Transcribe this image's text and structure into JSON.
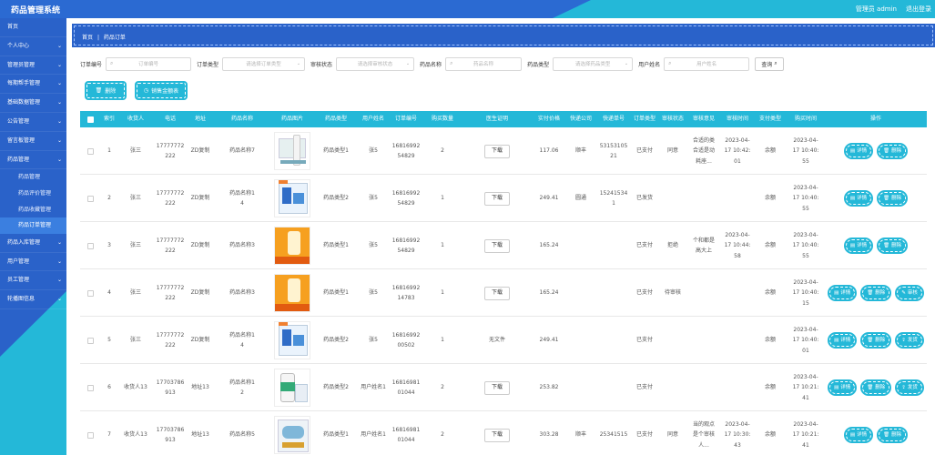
{
  "app": {
    "title": "药品管理系统",
    "user_label": "管理员 admin",
    "logout_label": "退出登录"
  },
  "sidebar": {
    "items": [
      {
        "label": "首页",
        "chevron": false
      },
      {
        "label": "个人中心",
        "chevron": true
      },
      {
        "label": "管理员管理",
        "chevron": true
      },
      {
        "label": "每期帮手管理",
        "chevron": true
      },
      {
        "label": "基础数据管理",
        "chevron": true
      },
      {
        "label": "公告管理",
        "chevron": true
      },
      {
        "label": "留言板管理",
        "chevron": true
      },
      {
        "label": "药品管理",
        "chevron": true
      }
    ],
    "subitems": [
      "药品管理",
      "药品评价管理",
      "药品收藏管理",
      "药品订单管理"
    ],
    "items_after": [
      {
        "label": "药品入库管理",
        "chevron": true
      },
      {
        "label": "用户管理",
        "chevron": true
      },
      {
        "label": "员工管理",
        "chevron": true
      },
      {
        "label": "轮播图信息",
        "chevron": true
      }
    ]
  },
  "breadcrumb": {
    "home": "首页",
    "sep": "|",
    "current": "药品订单"
  },
  "filters": {
    "order_no_label": "订单编号",
    "order_no_placeholder": "订单编号",
    "order_type_label": "订单类型",
    "order_type_placeholder": "请选择订单类型",
    "audit_label": "审核状态",
    "audit_placeholder": "请选择审核状态",
    "drug_name_label": "药品名称",
    "drug_name_placeholder": "药品名称",
    "drug_type_label": "药品类型",
    "drug_type_placeholder": "请选择药品类型",
    "user_name_label": "用户姓名",
    "user_name_placeholder": "用户姓名",
    "search_label": "查询"
  },
  "actions": {
    "delete_label": "删除",
    "report_label": "销售金额表"
  },
  "table": {
    "headers": [
      "索引",
      "收货人",
      "电话",
      "地址",
      "药品名称",
      "药品图片",
      "药品类型",
      "用户姓名",
      "订单编号",
      "购买数量",
      "医生证明",
      "实付价格",
      "快递公司",
      "快递单号",
      "订单类型",
      "审核状态",
      "审核意见",
      "审核时间",
      "支付类型",
      "购买时间",
      "操作"
    ],
    "rows": [
      {
        "idx": "1",
        "receiver": "张三",
        "phone": [
          "17777772",
          "222"
        ],
        "addr": "ZD复制",
        "drug": [
          "药品名称7"
        ],
        "img": "spray",
        "dtype": "药品类型1",
        "user": "张5",
        "order_no": [
          "16816992",
          "54829"
        ],
        "qty": "2",
        "cert": "下载",
        "cert_btn": true,
        "price": "117.06",
        "express": "顺丰",
        "tracking": [
          "53153105",
          "21"
        ],
        "otype": "已支付",
        "audit": "同意",
        "opinion": [
          "合适的类",
          "合适是动",
          "耗座..."
        ],
        "atime": [
          "2023-04-",
          "17 10:42:",
          "01"
        ],
        "pay": "余额",
        "btime": [
          "2023-04-",
          "17 10:40:",
          "55"
        ],
        "ops": [
          "详情",
          "删除"
        ]
      },
      {
        "idx": "2",
        "receiver": "张三",
        "phone": [
          "17777772",
          "222"
        ],
        "addr": "ZD复制",
        "drug": [
          "药品名称1",
          "4"
        ],
        "img": "blue",
        "dtype": "药品类型2",
        "user": "张5",
        "order_no": [
          "16816992",
          "54829"
        ],
        "qty": "1",
        "cert": "下载",
        "cert_btn": true,
        "price": "249.41",
        "express": "圆通",
        "tracking": [
          "15241534",
          "1"
        ],
        "otype": "已发货",
        "audit": "",
        "opinion": [],
        "atime": [],
        "pay": "余额",
        "btime": [
          "2023-04-",
          "17 10:40:",
          "55"
        ],
        "ops": [
          "详情",
          "删除"
        ]
      },
      {
        "idx": "3",
        "receiver": "张三",
        "phone": [
          "17777772",
          "222"
        ],
        "addr": "ZD复制",
        "drug": [
          "药品名称3"
        ],
        "img": "orange",
        "dtype": "药品类型1",
        "user": "张5",
        "order_no": [
          "16816992",
          "54829"
        ],
        "qty": "1",
        "cert": "下载",
        "cert_btn": true,
        "price": "165.24",
        "express": "",
        "tracking": [],
        "otype": "已支付",
        "audit": "拒绝",
        "opinion": [
          "个和都是",
          "高大上"
        ],
        "atime": [
          "2023-04-",
          "17 10:44:",
          "58"
        ],
        "pay": "余额",
        "btime": [
          "2023-04-",
          "17 10:40:",
          "55"
        ],
        "ops": [
          "详情",
          "删除"
        ]
      },
      {
        "idx": "4",
        "receiver": "张三",
        "phone": [
          "17777772",
          "222"
        ],
        "addr": "ZD复制",
        "drug": [
          "药品名称3"
        ],
        "img": "orange",
        "dtype": "药品类型1",
        "user": "张5",
        "order_no": [
          "16816992",
          "14783"
        ],
        "qty": "1",
        "cert": "下载",
        "cert_btn": true,
        "price": "165.24",
        "express": "",
        "tracking": [],
        "otype": "已支付",
        "audit": "待审核",
        "opinion": [],
        "atime": [],
        "pay": "余额",
        "btime": [
          "2023-04-",
          "17 10:40:",
          "15"
        ],
        "ops": [
          "详情",
          "删除",
          "审核"
        ]
      },
      {
        "idx": "5",
        "receiver": "张三",
        "phone": [
          "17777772",
          "222"
        ],
        "addr": "ZD复制",
        "drug": [
          "药品名称1",
          "4"
        ],
        "img": "blue",
        "dtype": "药品类型2",
        "user": "张5",
        "order_no": [
          "16816992",
          "00502"
        ],
        "qty": "1",
        "cert": "无文件",
        "cert_btn": false,
        "price": "249.41",
        "express": "",
        "tracking": [],
        "otype": "已支付",
        "audit": "",
        "opinion": [],
        "atime": [],
        "pay": "余额",
        "btime": [
          "2023-04-",
          "17 10:40:",
          "01"
        ],
        "ops": [
          "详情",
          "删除",
          "发货"
        ]
      },
      {
        "idx": "6",
        "receiver": "收货人13",
        "phone": [
          "17703786",
          "913"
        ],
        "addr": "地址13",
        "drug": [
          "药品名称1",
          "2"
        ],
        "img": "bottle",
        "dtype": "药品类型2",
        "user": "用户姓名1",
        "order_no": [
          "16816981",
          "01044"
        ],
        "qty": "2",
        "cert": "下载",
        "cert_btn": true,
        "price": "253.82",
        "express": "",
        "tracking": [],
        "otype": "已支付",
        "audit": "",
        "opinion": [],
        "atime": [],
        "pay": "余额",
        "btime": [
          "2023-04-",
          "17 10:21:",
          "41"
        ],
        "ops": [
          "详情",
          "删除",
          "发货"
        ]
      },
      {
        "idx": "7",
        "receiver": "收货人13",
        "phone": [
          "17703786",
          "913"
        ],
        "addr": "地址13",
        "drug": [
          "药品名称5"
        ],
        "img": "mask",
        "dtype": "药品类型1",
        "user": "用户姓名1",
        "order_no": [
          "16816981",
          "01044"
        ],
        "qty": "2",
        "cert": "下载",
        "cert_btn": true,
        "price": "303.28",
        "express": "顺丰",
        "tracking": [
          "25341515"
        ],
        "otype": "已支付",
        "audit": "同意",
        "opinion": [
          "当的观点",
          "是个审核",
          "人..."
        ],
        "atime": [
          "2023-04-",
          "17 10:30:",
          "43"
        ],
        "pay": "余额",
        "btime": [
          "2023-04-",
          "17 10:21:",
          "41"
        ],
        "ops": [
          "详情",
          "删除"
        ]
      }
    ]
  },
  "colors": {
    "primary": "#2a62c9",
    "accent": "#24b8d8"
  }
}
